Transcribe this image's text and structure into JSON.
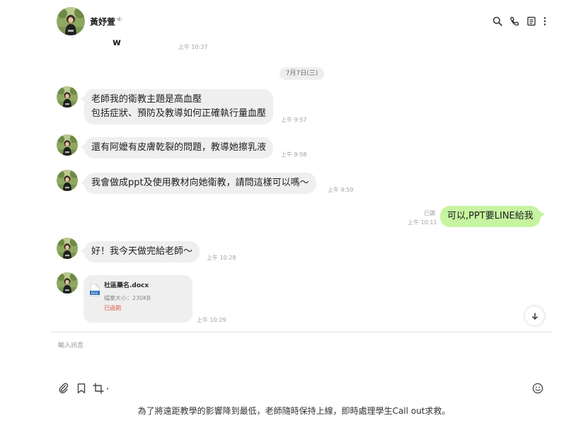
{
  "header": {
    "contact_name": "黃妤萱",
    "icons": [
      "speaker-icon",
      "search-icon",
      "phone-icon",
      "note-icon",
      "more-icon"
    ]
  },
  "messages": {
    "prev_fragment": "ᴡ",
    "prev_time": "上午 10:37",
    "date_separator": "7月7日(三)",
    "m1_text": "老師我的衛教主題是高血壓\n包括症狀、預防及教導如何正確執行量血壓",
    "m1_time": "上午 9:57",
    "m2_text": "還有阿嬤有皮膚乾裂的問題，教導她擦乳液",
    "m2_time": "上午 9:58",
    "m3_text": "我會做成ppt及使用教材向她衛教，請問這樣可以嗎～",
    "m3_time": "上午 9:59",
    "out_read": "已讀",
    "out_time": "上午 10:11",
    "out_text": "可以,PPT要LINE給我",
    "m4_text": "好！我今天做完給老師～",
    "m4_time": "上午 10:28",
    "file_name": "社區藥名.docx",
    "file_size": "檔案大小：230KB",
    "file_status": "已過期",
    "file_time": "上午 10:29",
    "doc_label": "DOC"
  },
  "composer": {
    "placeholder": "輸入訊息",
    "icons": [
      "paperclip-icon",
      "bookmark-icon",
      "crop-icon",
      "emoji-icon"
    ]
  },
  "caption": "為了將遠距教學的影響降到最低，老師隨時保持上線，即時處理學生Call out求救。",
  "colors": {
    "outgoing_bubble": "#c6f4a0",
    "incoming_bubble": "#efefef",
    "expired": "#e25a4f"
  }
}
